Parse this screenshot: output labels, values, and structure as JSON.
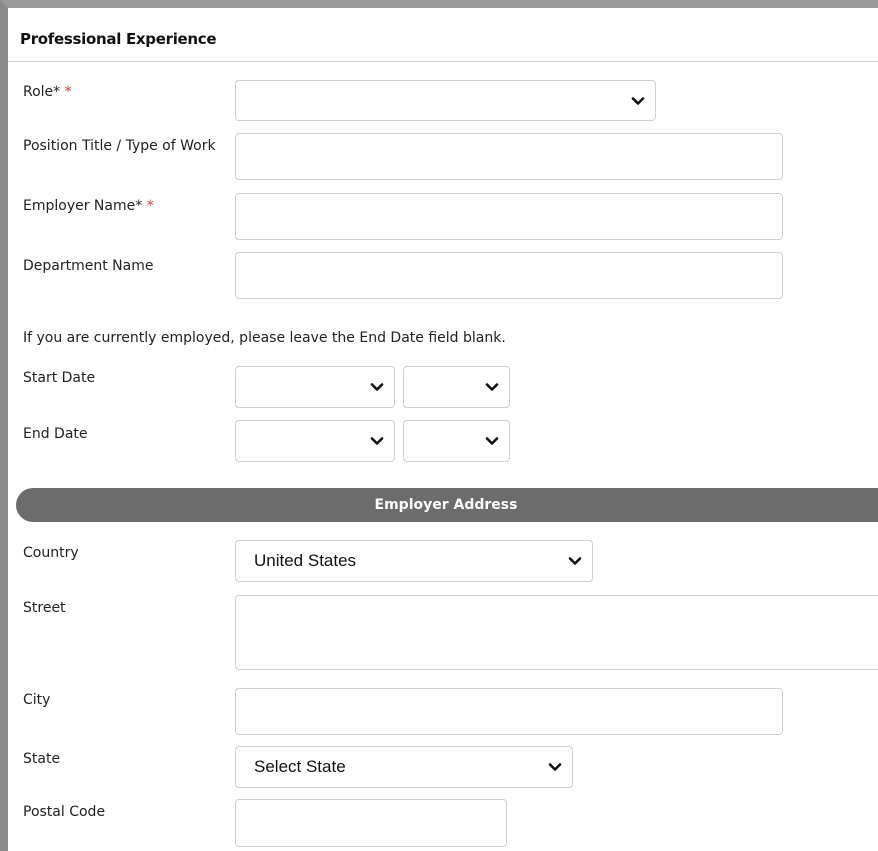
{
  "section": {
    "title": "Professional Experience"
  },
  "fields": {
    "role": {
      "label": "Role*",
      "required_mark": "*",
      "value": ""
    },
    "position": {
      "label": "Position Title / Type of Work",
      "value": ""
    },
    "employer": {
      "label": "Employer Name*",
      "required_mark": "*",
      "value": ""
    },
    "department": {
      "label": "Department Name",
      "value": ""
    },
    "dates_note": "If you are currently employed, please leave the End Date field blank.",
    "start_date": {
      "label": "Start Date",
      "month": "",
      "year": ""
    },
    "end_date": {
      "label": "End Date",
      "month": "",
      "year": ""
    }
  },
  "address": {
    "header": "Employer Address",
    "country": {
      "label": "Country",
      "value": "United States"
    },
    "street": {
      "label": "Street",
      "value": ""
    },
    "city": {
      "label": "City",
      "value": ""
    },
    "state": {
      "label": "State",
      "value": "Select State"
    },
    "postal": {
      "label": "Postal Code",
      "value": ""
    }
  },
  "icons": {
    "dropdown": "chevron-down-icon"
  },
  "colors": {
    "required": "#e03030",
    "band": "#6c6c6c"
  }
}
